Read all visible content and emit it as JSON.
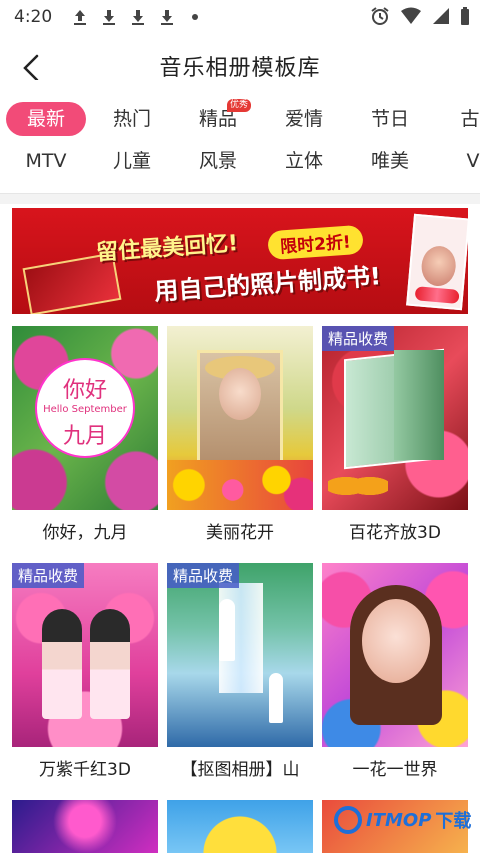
{
  "status": {
    "time": "4:20"
  },
  "header": {
    "title": "音乐相册模板库"
  },
  "tabs": {
    "row1": [
      {
        "label": "最新",
        "active": true
      },
      {
        "label": "热门"
      },
      {
        "label": "精品",
        "badge": "优秀"
      },
      {
        "label": "爱情"
      },
      {
        "label": "节日"
      },
      {
        "label": "古"
      }
    ],
    "row2": [
      {
        "label": "MTV"
      },
      {
        "label": "儿童"
      },
      {
        "label": "风景"
      },
      {
        "label": "立体"
      },
      {
        "label": "唯美"
      },
      {
        "label": "V"
      }
    ]
  },
  "banner": {
    "line1": "留住最美回忆!",
    "pill": "限时2折!",
    "line2": "用自己的照片制成书!"
  },
  "templates": [
    {
      "title": "你好，九月",
      "art_line1": "你好",
      "art_line2": "Hello September",
      "art_line3": "九月"
    },
    {
      "title": "美丽花开"
    },
    {
      "title": "百花齐放3D",
      "tag": "精品收费"
    },
    {
      "title": "万紫千红3D",
      "tag": "精品收费"
    },
    {
      "title": "【抠图相册】山",
      "tag": "精品收费"
    },
    {
      "title": "一花一世界"
    }
  ],
  "watermark": {
    "brand": "ITMOP",
    "suffix": "下载"
  },
  "colors": {
    "accent": "#f24b78",
    "tag_bg": "#4a5bc8",
    "banner_red": "#d8141c"
  }
}
